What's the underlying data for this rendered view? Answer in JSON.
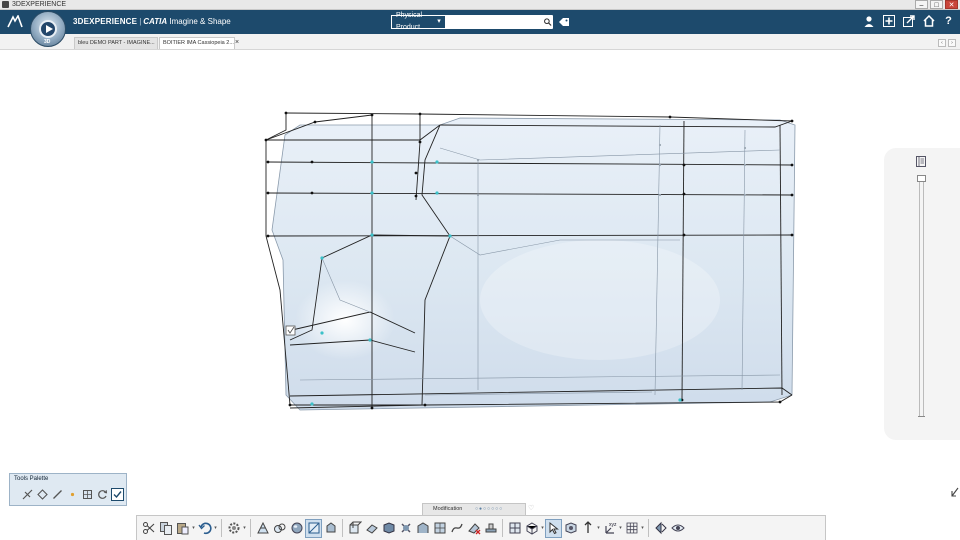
{
  "window": {
    "title": "3DEXPERIENCE",
    "controls": [
      "–",
      "□",
      "✕"
    ]
  },
  "topbar": {
    "brand_main": "3DEXPERIENCE",
    "brand_separator": "|",
    "brand_catia": "CATIA",
    "brand_app": "Imagine & Shape",
    "compass_tag": "3D",
    "search": {
      "scope": "Physical Product",
      "scope_arrow": "▾",
      "placeholder": "",
      "value": ""
    },
    "icons": [
      "user-icon",
      "add-icon",
      "share-icon",
      "home-icon",
      "help-icon"
    ],
    "help_glyph": "?"
  },
  "tabs": [
    {
      "label": "bleu DEMO PART - IMAGINE...",
      "active": false
    },
    {
      "label": "BOITIER IMA Cassiopeia 2...",
      "active": true
    }
  ],
  "tab_close": "×",
  "tab_nav": [
    "‹",
    "›"
  ],
  "tools_palette": {
    "title": "Tools Palette",
    "tools": [
      "attract-icon",
      "diamond-edit-icon",
      "line-tool-icon",
      "sparkle-icon",
      "subdivide-icon",
      "refresh-icon",
      "checkbox-icon"
    ]
  },
  "modification_tab": {
    "label": "Modification",
    "dots": "○●○○○○○"
  },
  "action_bar": {
    "groups": [
      [
        "cut-icon",
        "copy-icon",
        "paste-icon",
        "undo-icon"
      ],
      [
        "settings-gear-icon"
      ],
      [
        "subdivision-surface-icon",
        "sculpt-icon",
        "sphere-icon",
        "modify-icon",
        "extrude-icon"
      ],
      [
        "edge-tool-icon",
        "face-tool-icon",
        "vertex-tool-icon",
        "mirror-icon",
        "fold-icon",
        "cage-icon",
        "twist-icon",
        "erase-icon",
        "stamp-icon"
      ],
      [
        "symmetry-icon",
        "box-select-icon",
        "pointer-icon"
      ],
      [
        "snap-icon",
        "axis-icon",
        "xyz-icon",
        "grid-icon"
      ],
      [
        "view-icon",
        "visibility-icon"
      ]
    ]
  },
  "colors": {
    "titlebar": "#1d4a6c",
    "accent_teal": "#3cc1c9",
    "cage_line": "#111111",
    "surface_fill": "#dfe9f3"
  }
}
